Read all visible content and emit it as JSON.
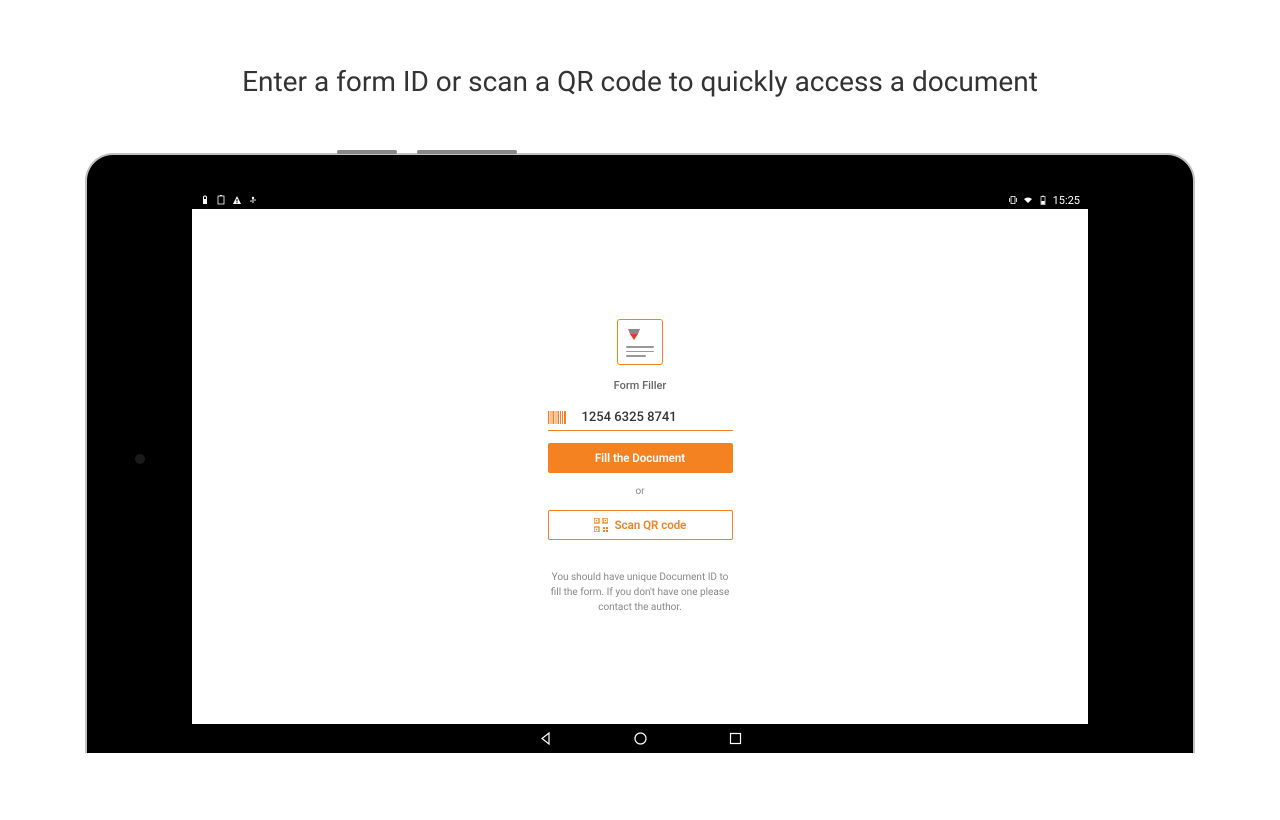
{
  "page": {
    "title": "Enter a form ID or scan a QR code to quickly access a document"
  },
  "statusBar": {
    "time": "15:25"
  },
  "app": {
    "name": "Form Filler",
    "formIdValue": "1254 6325 8741",
    "fillButtonLabel": "Fill the Document",
    "orLabel": "or",
    "scanButtonLabel": "Scan QR code",
    "helpText": "You should have unique Document ID to fill the form. If you don't have one please contact the author."
  },
  "colors": {
    "accent": "#f58220"
  }
}
